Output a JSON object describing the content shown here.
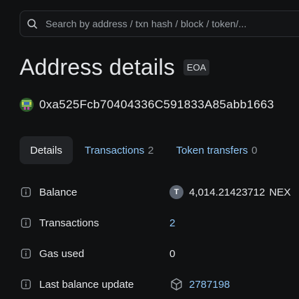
{
  "search": {
    "placeholder": "Search by address / txn hash / block / token/..."
  },
  "header": {
    "title": "Address details",
    "badge": "EOA"
  },
  "address": {
    "value": "0xa525Fcb70404336C591833A85abb1663"
  },
  "tabs": [
    {
      "label": "Details",
      "count": ""
    },
    {
      "label": "Transactions",
      "count": "2"
    },
    {
      "label": "Token transfers",
      "count": "0"
    }
  ],
  "details": {
    "balance": {
      "label": "Balance",
      "token_glyph": "T",
      "amount": "4,014.21423712",
      "symbol": "NEX"
    },
    "transactions": {
      "label": "Transactions",
      "value": "2"
    },
    "gas_used": {
      "label": "Gas used",
      "value": "0"
    },
    "last_balance_update": {
      "label": "Last balance update",
      "value": "2787198"
    }
  },
  "colors": {
    "background": "#101112",
    "link": "#8ec5f5",
    "muted": "#8d9399",
    "active_tab_bg": "#212326"
  },
  "icons": {
    "search": "search-icon",
    "info": "info-icon",
    "token": "token-icon",
    "block": "block-cube-icon",
    "avatar": "identicon-avatar"
  }
}
